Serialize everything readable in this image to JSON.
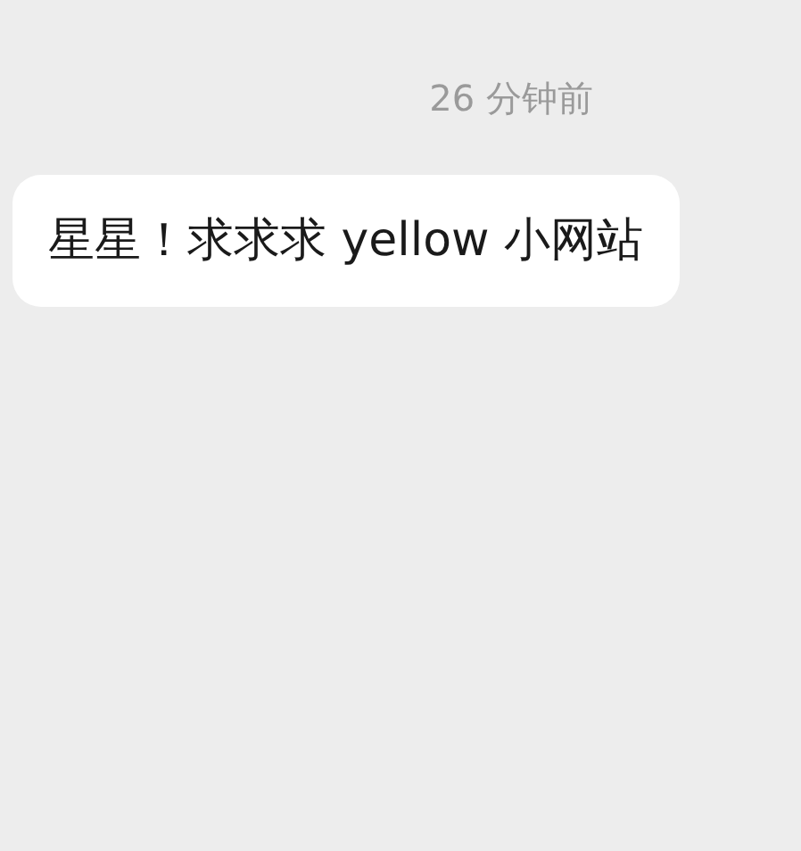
{
  "timestamp": "26 分钟前",
  "messages": [
    {
      "text": "星星！求求求 yellow 小网站"
    }
  ]
}
